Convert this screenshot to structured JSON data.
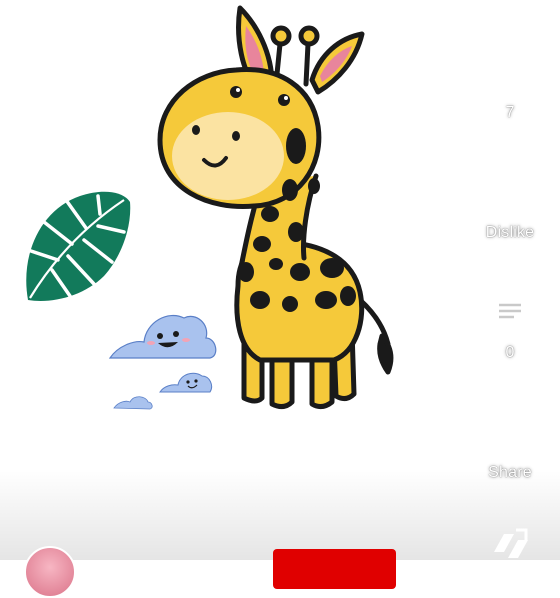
{
  "actions": {
    "like_count": "7",
    "dislike_label": "Dislike",
    "comment_count": "0",
    "share_label": "Share"
  },
  "channel": {
    "subscribe_label": ""
  },
  "colors": {
    "giraffe_yellow": "#f5c93a",
    "giraffe_spot": "#1a1a1a",
    "cloud_blue": "#a9c2ee",
    "leaf_green": "#127a5b",
    "subscribe_red": "#e00000"
  }
}
